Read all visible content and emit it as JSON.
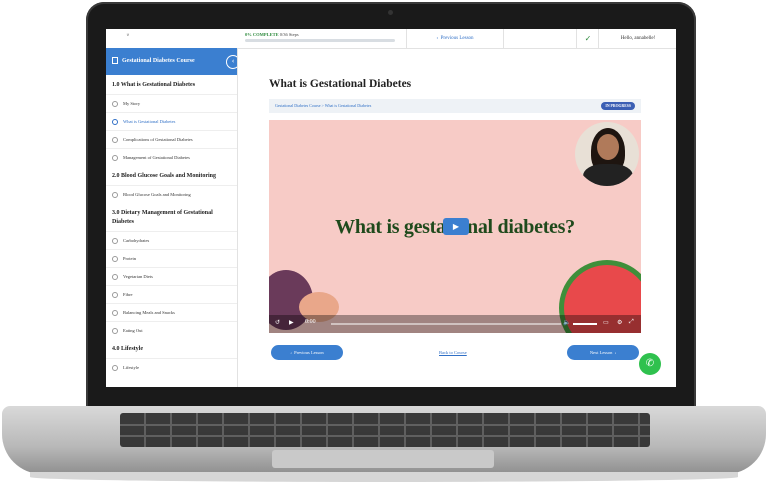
{
  "topbar": {
    "progress_percent_label": "0% COMPLETE",
    "progress_steps_label": "0/36 Steps",
    "progress_fraction": 0,
    "previous_lesson": "Previous Lesson",
    "greeting": "Hello, annabelle!"
  },
  "sidebar": {
    "course_title": "Gestational Diabetes Course",
    "sections": [
      {
        "title": "1.0 What is Gestational Diabetes",
        "lessons": [
          "My Story",
          "What is Gestational Diabetes",
          "Complications of Gestational Diabetes",
          "Management of Gestational Diabetes"
        ]
      },
      {
        "title": "2.0 Blood Glucose Goals and Monitoring",
        "lessons": [
          "Blood Glucose Goals and Monitoring"
        ]
      },
      {
        "title": "3.0 Dietary Management of Gestational Diabetes",
        "lessons": [
          "Carbohydrates",
          "Protein",
          "Vegetarian Diets",
          "Fibre",
          "Balancing Meals and Snacks",
          "Eating Out"
        ]
      },
      {
        "title": "4.0 Lifestyle",
        "lessons": [
          "Lifestyle"
        ]
      }
    ]
  },
  "main": {
    "title": "What is Gestational Diabetes",
    "breadcrumb": "Gestational Diabetes Course > What is Gestational Diabetes",
    "status": "IN PROGRESS",
    "video_caption": "What is gestational diabetes?",
    "video_time": "0:00",
    "prev_button": "Previous Lesson",
    "back_link": "Back to Course",
    "next_button": "Next Lesson"
  },
  "colors": {
    "accent": "#3b7fd0",
    "progress": "#2f8b3f",
    "video_bg": "#f7cbc6",
    "caption": "#1f4a1c",
    "whatsapp": "#2fc14e"
  },
  "icons": [
    "document-icon",
    "chevron-left-icon",
    "checkmark-icon",
    "play-icon",
    "volume-icon",
    "fullscreen-icon",
    "settings-icon",
    "whatsapp-icon"
  ]
}
